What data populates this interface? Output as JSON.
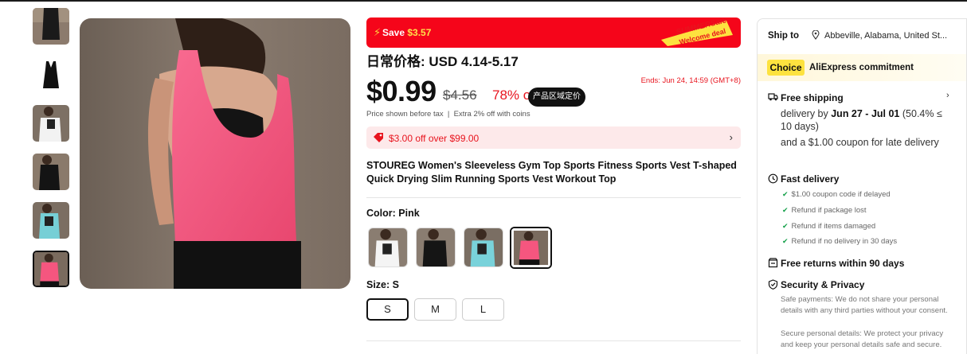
{
  "thumbnails": [
    {
      "name": "thumb-black-top"
    },
    {
      "name": "thumb-black-tank"
    },
    {
      "name": "thumb-white-tank"
    },
    {
      "name": "thumb-black-worn"
    },
    {
      "name": "thumb-cyan-tank"
    },
    {
      "name": "thumb-pink-tank"
    }
  ],
  "promo": {
    "save_label": "Save",
    "save_amount": "$3.57",
    "badge_line1": "SUMMERSale",
    "badge_line2": "Welcome deal"
  },
  "price": {
    "reference": "日常价格: USD 4.14-5.17",
    "current": "$0.99",
    "original": "$4.56",
    "discount": "78% off",
    "region_tag": "产品区域定价",
    "ends": "Ends: Jun 24, 14:59 (GMT+8)",
    "tax_note": "Price shown before tax",
    "coins_note": "Extra 2% off with coins"
  },
  "coupon": {
    "text": "$3.00 off over $99.00"
  },
  "product": {
    "title": "STOUREG Women's Sleeveless Gym Top Sports Fitness Sports Vest T-shaped Quick Drying Slim Running Sports Vest Workout Top"
  },
  "color": {
    "label": "Color:",
    "selected": "Pink",
    "options": [
      "White",
      "Black",
      "Cyan",
      "Pink"
    ]
  },
  "size": {
    "label": "Size:",
    "selected": "S",
    "options": [
      "S",
      "M",
      "L"
    ]
  },
  "shipping": {
    "ship_to_label": "Ship to",
    "location": "Abbeville, Alabama, United St...",
    "choice_badge": "Choice",
    "commitment": "AliExpress commitment",
    "free_shipping": "Free shipping",
    "delivery_prefix": "delivery by",
    "delivery_dates": "Jun 27 - Jul 01",
    "delivery_rate": "(50.4% ≤ 10 days)",
    "late_coupon": "and a $1.00 coupon for late delivery",
    "fast_delivery": "Fast delivery",
    "fast_items": [
      "$1.00 coupon code if delayed",
      "Refund if package lost",
      "Refund if items damaged",
      "Refund if no delivery in 30 days"
    ],
    "free_returns": "Free returns within 90 days",
    "security": "Security & Privacy",
    "safe_payments": "Safe payments: We do not share your personal details with any third parties without your consent.",
    "secure_details": "Secure personal details: We protect your privacy and keep your personal details safe and secure."
  },
  "colors": {
    "sale_red": "#f5051a",
    "price_red": "#e8141e",
    "choice_yellow": "#fde23f",
    "check_green": "#15a04a",
    "product_pink": "#f5567f"
  }
}
